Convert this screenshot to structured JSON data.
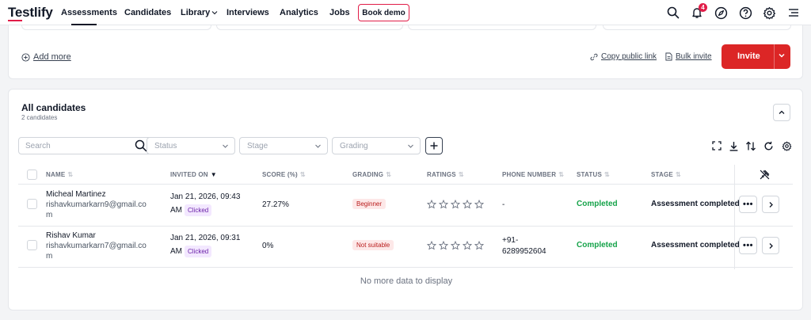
{
  "app": {
    "logo": "Testlify",
    "accent": "#dc2626"
  },
  "nav": {
    "items": [
      {
        "label": "Assessments",
        "active": true
      },
      {
        "label": "Candidates"
      },
      {
        "label": "Library"
      },
      {
        "label": "Interviews"
      },
      {
        "label": "Analytics"
      },
      {
        "label": "Jobs"
      }
    ],
    "library_label": "Library",
    "book_demo": "Book demo",
    "notification_count": "4",
    "icons": [
      "search-icon",
      "bell-icon",
      "compass-icon",
      "help-icon",
      "gear-icon",
      "menu-icon"
    ]
  },
  "top_card": {
    "add_more": "Add more",
    "copy_link": "Copy public link",
    "bulk_invite": "Bulk invite",
    "invite": "Invite"
  },
  "candidates": {
    "title": "All candidates",
    "count": "2 candidates",
    "search_placeholder": "Search",
    "filters": {
      "status": "Status",
      "stage": "Stage",
      "grading": "Grading"
    },
    "columns": {
      "name": "NAME",
      "invited_on": "INVITED ON",
      "score": "SCORE (%)",
      "grading": "GRADING",
      "ratings": "RATINGS",
      "phone": "PHONE NUMBER",
      "status": "STATUS",
      "stage": "STAGE"
    },
    "rows": [
      {
        "name": "Micheal Martinez",
        "email_line1": "rishavkumarkarn9@gmail.co",
        "email_line2": "m",
        "invited_line1": "Jan 21, 2026, 09:43",
        "invited_line2": "AM",
        "clicked": "Clicked",
        "score": "27.27%",
        "grading": "Beginner",
        "rating": 0,
        "phone_line1": "-",
        "phone_line2": "",
        "status": "Completed",
        "stage": "Assessment completed"
      },
      {
        "name": "Rishav Kumar",
        "email_line1": "rishavkumarkarn7@gmail.co",
        "email_line2": "m",
        "invited_line1": "Jan 21, 2026, 09:31",
        "invited_line2": "AM",
        "clicked": "Clicked",
        "score": "0%",
        "grading": "Not suitable",
        "rating": 0,
        "phone_line1": "+91-",
        "phone_line2": "6289952604",
        "status": "Completed",
        "stage": "Assessment completed"
      }
    ],
    "row_actions": "•••",
    "empty_note": "No more data to display"
  }
}
